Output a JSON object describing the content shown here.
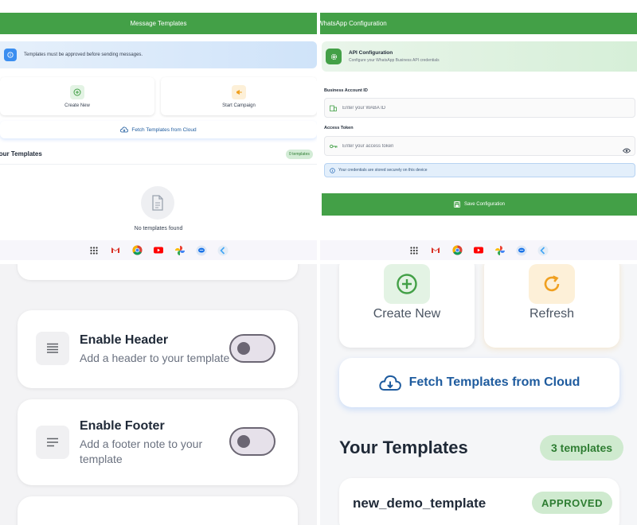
{
  "templates_screen": {
    "title": "Message Templates",
    "info_banner": "Templates must be approved before sending messages.",
    "create_new_label": "Create New",
    "start_campaign_label": "Start Campaign",
    "fetch_label": "Fetch Templates from Cloud",
    "your_templates": "Your Templates",
    "count_badge": "0 templates",
    "empty_title": "No templates found"
  },
  "config_screen": {
    "title": "WhatsApp Configuration",
    "api_title": "API Configuration",
    "api_subtitle": "Configure your WhatsApp Business API credentials",
    "business_account_label": "Business Account ID",
    "waba_placeholder": "Enter your WABA ID",
    "access_token_label": "Access Token",
    "token_placeholder": "Enter your access token",
    "secure_note": "Your credentials are stored securely on this device",
    "save_label": "Save Configuration"
  },
  "template_options": {
    "header_title": "Enable Header",
    "header_sub": "Add a header to your template",
    "footer_title": "Enable Footer",
    "footer_sub": "Add a footer note to your template",
    "header_enabled": false,
    "footer_enabled": false
  },
  "templates_list": {
    "create_new_label": "Create New",
    "refresh_label": "Refresh",
    "fetch_label": "Fetch Templates from Cloud",
    "your_templates": "Your Templates",
    "count_badge": "3 templates",
    "rows": [
      {
        "name": "new_demo_template",
        "status": "APPROVED"
      }
    ]
  },
  "colors": {
    "brand_green": "#43a047",
    "info_blue": "#3b8ef0",
    "link_blue": "#1e5b9e",
    "approved_bg": "#cfeacf"
  },
  "icons": {
    "nav": [
      "apps-grid-icon",
      "gmail-icon",
      "chrome-icon",
      "youtube-icon",
      "photos-icon",
      "messages-icon",
      "flutter-icon"
    ]
  }
}
